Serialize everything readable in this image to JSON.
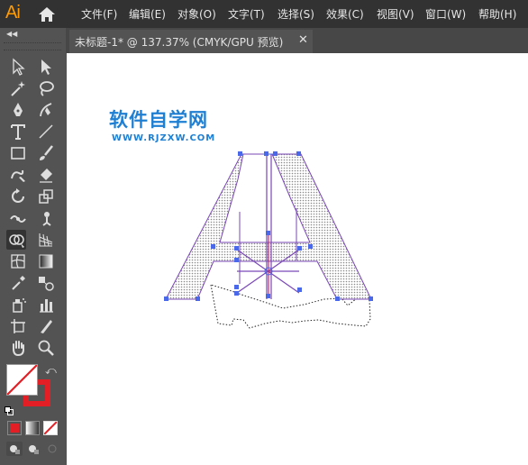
{
  "app": {
    "logo": "Ai"
  },
  "menu": [
    "文件(F)",
    "编辑(E)",
    "对象(O)",
    "文字(T)",
    "选择(S)",
    "效果(C)",
    "视图(V)",
    "窗口(W)",
    "帮助(H)"
  ],
  "document_tab": {
    "title": "未标题-1* @ 137.37% (CMYK/GPU 预览)",
    "close": "✕"
  },
  "canvas": {
    "watermark_title": "软件自学网",
    "watermark_url": "WWW.RJZXW.COM"
  },
  "tools": [
    "selection-tool",
    "direct-selection-tool",
    "magic-wand-tool",
    "lasso-tool",
    "pen-tool",
    "curvature-tool",
    "type-tool",
    "line-tool",
    "rectangle-tool",
    "paintbrush-tool",
    "shaper-tool",
    "eraser-tool",
    "rotate-tool",
    "scale-tool",
    "width-tool",
    "puppet-warp-tool",
    "shape-builder-tool",
    "perspective-grid-tool",
    "mesh-tool",
    "gradient-tool",
    "eyedropper-tool",
    "blend-tool",
    "symbol-sprayer-tool",
    "column-graph-tool",
    "artboard-tool",
    "slice-tool",
    "hand-tool",
    "zoom-tool"
  ],
  "colors": {
    "accent": "#ff9a00",
    "selection": "#4a68e8",
    "stroke_swatch": "#e31e24",
    "watermark": "#1f7fd2"
  }
}
